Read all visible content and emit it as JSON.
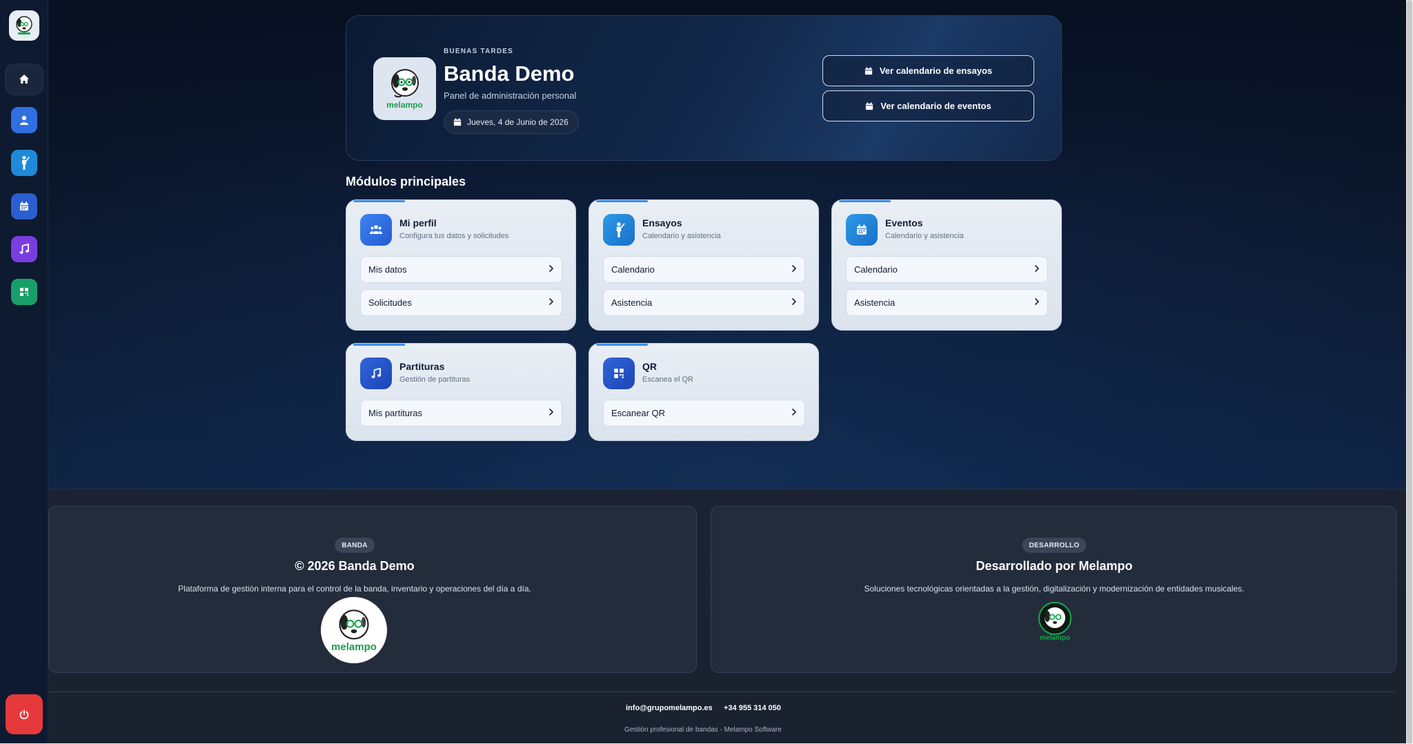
{
  "colors": {
    "accent": "#3b8fe8",
    "logout": "#e6393b",
    "sidebar_profile": "#2f6fe0",
    "sidebar_rehearsals": "#1f8ad9",
    "sidebar_calendar": "#2b5fd0",
    "sidebar_music": "#7a3ee0",
    "sidebar_qr": "#18a06a"
  },
  "sidebar": {
    "items": [
      {
        "name": "home-icon"
      },
      {
        "name": "user-icon"
      },
      {
        "name": "conductor-icon"
      },
      {
        "name": "calendar-icon"
      },
      {
        "name": "music-icon"
      },
      {
        "name": "qr-icon"
      }
    ],
    "logout_icon": "power-icon"
  },
  "hero": {
    "greeting": "BUENAS TARDES",
    "title": "Banda Demo",
    "subtitle": "Panel de administración personal",
    "date": "Jueves, 4 de Junio de 2026",
    "logo_text": "melampo",
    "buttons": [
      {
        "label": "Ver calendario de ensayos"
      },
      {
        "label": "Ver calendario de eventos"
      }
    ]
  },
  "modules": {
    "title": "Módulos principales",
    "cards": [
      {
        "title": "Mi perfil",
        "subtitle": "Configura tus datos y solicitudes",
        "icon": "users-icon",
        "items": [
          "Mis datos",
          "Solicitudes"
        ]
      },
      {
        "title": "Ensayos",
        "subtitle": "Calendario y asistencia",
        "icon": "conductor-icon",
        "items": [
          "Calendario",
          "Asistencia"
        ]
      },
      {
        "title": "Eventos",
        "subtitle": "Calendario y asistencia",
        "icon": "calendar-icon",
        "items": [
          "Calendario",
          "Asistencia"
        ]
      },
      {
        "title": "Partituras",
        "subtitle": "Gestión de partituras",
        "icon": "music-icon",
        "items": [
          "Mis partituras"
        ]
      },
      {
        "title": "QR",
        "subtitle": "Escanea el QR",
        "icon": "qr-icon",
        "items": [
          "Escanear QR"
        ]
      }
    ]
  },
  "footer": {
    "band": {
      "badge": "BANDA",
      "title": "© 2026 Banda Demo",
      "text": "Plataforma de gestión interna para el control de la banda, inventario y operaciones del día a día.",
      "logo_text": "melampo"
    },
    "dev": {
      "badge": "DESARROLLO",
      "title": "Desarrollado por Melampo",
      "text": "Soluciones tecnológicas orientadas a la gestión, digitalización y modernización de entidades musicales.",
      "logo_text": "melampo"
    },
    "email": "info@grupomelampo.es",
    "phone": "+34 955 314 050",
    "copy": "Gestión profesional de bandas - Melampo Software"
  }
}
